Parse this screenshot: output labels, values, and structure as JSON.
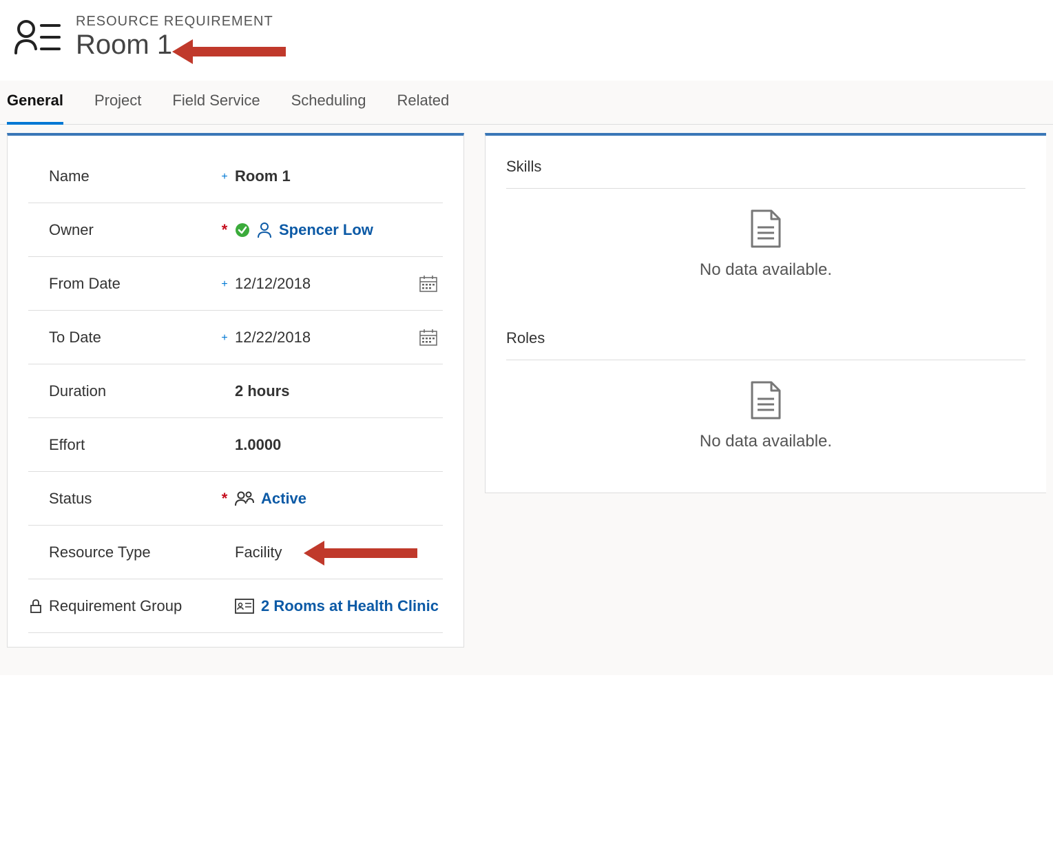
{
  "header": {
    "label": "RESOURCE REQUIREMENT",
    "title": "Room 1"
  },
  "tabs": [
    {
      "label": "General",
      "active": true
    },
    {
      "label": "Project",
      "active": false
    },
    {
      "label": "Field Service",
      "active": false
    },
    {
      "label": "Scheduling",
      "active": false
    },
    {
      "label": "Related",
      "active": false
    }
  ],
  "fields": {
    "name": {
      "label": "Name",
      "value": "Room 1"
    },
    "owner": {
      "label": "Owner",
      "value": "Spencer Low"
    },
    "from_date": {
      "label": "From Date",
      "value": "12/12/2018"
    },
    "to_date": {
      "label": "To Date",
      "value": "12/22/2018"
    },
    "duration": {
      "label": "Duration",
      "value": "2 hours"
    },
    "effort": {
      "label": "Effort",
      "value": "1.0000"
    },
    "status": {
      "label": "Status",
      "value": "Active"
    },
    "resource_type": {
      "label": "Resource Type",
      "value": "Facility"
    },
    "requirement_group": {
      "label": "Requirement Group",
      "value": "2 Rooms at Health Clinic"
    }
  },
  "sections": {
    "skills": {
      "title": "Skills",
      "no_data": "No data available."
    },
    "roles": {
      "title": "Roles",
      "no_data": "No data available."
    }
  }
}
